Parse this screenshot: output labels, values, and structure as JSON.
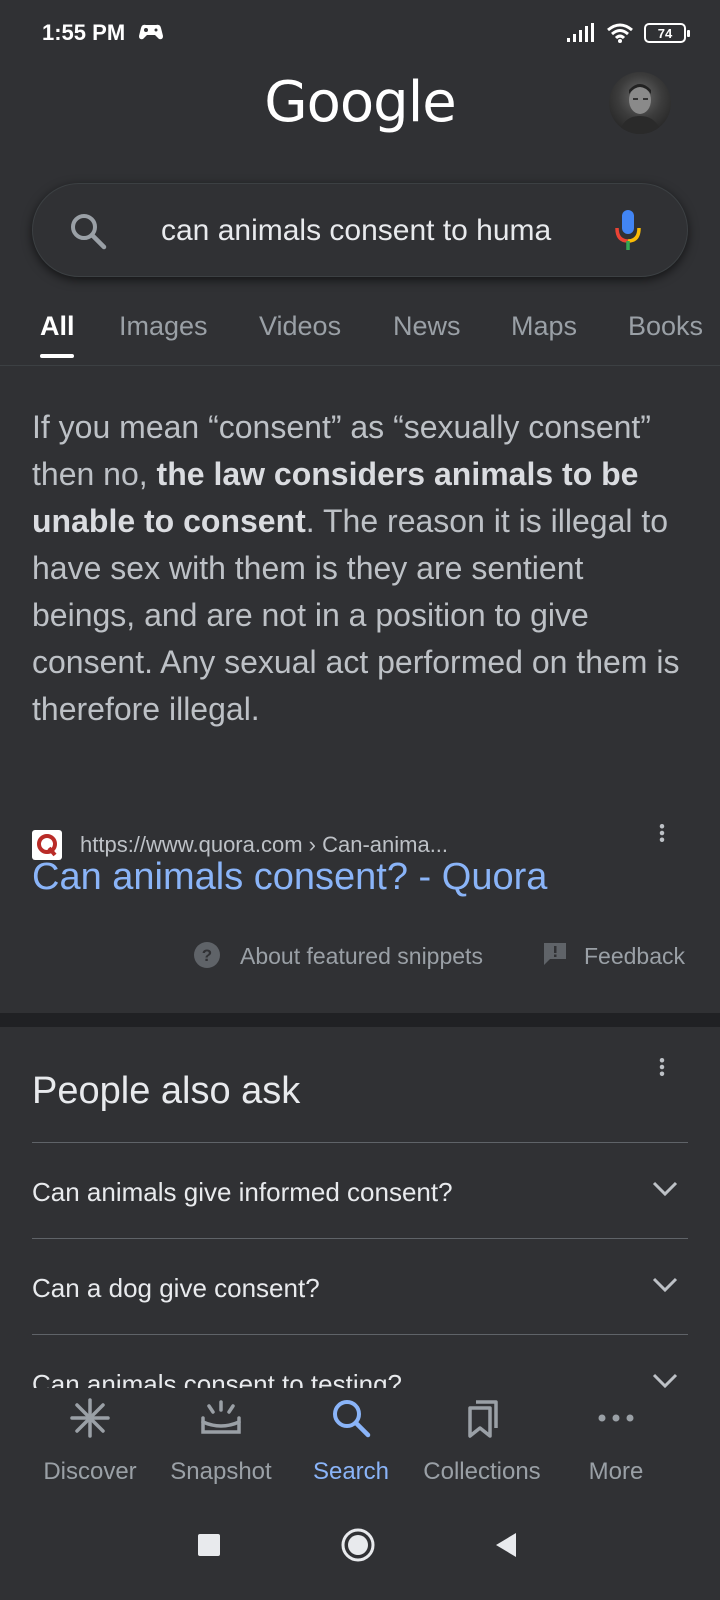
{
  "status": {
    "time": "1:55 PM",
    "battery": "74"
  },
  "header": {
    "logo": "Google"
  },
  "search": {
    "query": "can animals consent to human",
    "display_text": "can animals consent to huma"
  },
  "tabs": [
    "All",
    "Images",
    "Videos",
    "News",
    "Maps",
    "Books"
  ],
  "snippet": {
    "part1": "If you mean “consent” as “sexually consent” then no, ",
    "bold": "the law considers animals to be unable to consent",
    "part2": ". The reason it is illegal to have sex with them is they are sentient beings, and are not in a position to give consent. Any sexual act performed on them is therefore illegal.",
    "source_url": "https://www.quora.com › Can-anima...",
    "title": "Can animals consent? - Quora",
    "about_label": "About featured snippets",
    "feedback_label": "Feedback"
  },
  "paa": {
    "title": "People also ask",
    "questions": [
      "Can animals give informed consent?",
      "Can a dog give consent?",
      "Can animals consent to testing?"
    ]
  },
  "bottom_nav": [
    "Discover",
    "Snapshot",
    "Search",
    "Collections",
    "More"
  ],
  "colors": {
    "background": "#303134",
    "link": "#8ab4f8",
    "active_nav": "#8ab4f8"
  }
}
